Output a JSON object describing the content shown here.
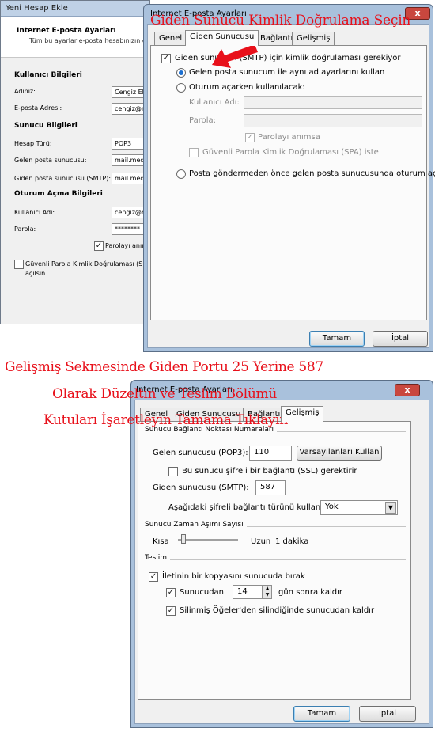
{
  "background_window": {
    "title": "Yeni Hesap Ekle",
    "header_title": "Internet E-posta Ayarları",
    "header_subtitle": "Tüm bu ayarlar e-posta hesabınızın çalışması",
    "user_info_title": "Kullanıcı Bilgileri",
    "name_label": "Adınız:",
    "name_value": "Cengiz El",
    "email_label": "E-posta Adresi:",
    "email_value": "cengiz@m",
    "server_info_title": "Sunucu Bilgileri",
    "account_type_label": "Hesap Türü:",
    "account_type_value": "POP3",
    "incoming_label": "Gelen posta sunucusu:",
    "incoming_value": "mail.med",
    "outgoing_label": "Giden posta sunucusu (SMTP):",
    "outgoing_value": "mail.med",
    "logon_info_title": "Oturum Açma Bilgileri",
    "username_label": "Kullanıcı Adı:",
    "username_value": "cengiz@m",
    "password_label": "Parola:",
    "password_value": "********",
    "remember_label": "Parolayı anım",
    "spa_label": "Güvenli Parola Kimlik Doğrulaması (SPA)",
    "spa_label_line2": "açılsın"
  },
  "dialog_top": {
    "title": "Internet E-posta Ayarları",
    "close_label": "x",
    "tabs": [
      "Genel",
      "Giden Sunucusu",
      "Bağlantı",
      "Gelişmiş"
    ],
    "smtp_auth_label": "Giden sunucum (SMTP) için kimlik doğrulaması gerekiyor",
    "same_settings_label": "Gelen posta sunucum ile aynı ad ayarlarını kullan",
    "logon_using_label": "Oturum açarken kullanılacak:",
    "username_label": "Kullanıcı Adı:",
    "password_label": "Parola:",
    "remember_label": "Parolayı anımsa",
    "spa_label": "Güvenli Parola Kimlik Doğrulaması (SPA) iste",
    "pop_before_smtp_label": "Posta göndermeden önce gelen posta sunucusunda oturum aç",
    "ok_label": "Tamam",
    "cancel_label": "İptal"
  },
  "dialog_bottom": {
    "title": "Internet E-posta Ayarları",
    "close_label": "x",
    "tabs": [
      "Genel",
      "Giden Sunucusu",
      "Bağlantı",
      "Gelişmiş"
    ],
    "port_group_title": "Sunucu Bağlantı Noktası Numaraları",
    "incoming_port_label": "Gelen sunucusu (POP3):",
    "incoming_port_value": "110",
    "defaults_button": "Varsayılanları Kullan",
    "ssl_label": "Bu sunucu şifreli bir bağlantı (SSL) gerektirir",
    "outgoing_port_label": "Giden sunucusu (SMTP):",
    "outgoing_port_value": "587",
    "encryption_label": "Aşağıdaki şifreli bağlantı türünü kullan:",
    "encryption_value": "Yok",
    "timeout_group_title": "Sunucu Zaman Aşımı Sayısı",
    "timeout_short": "Kısa",
    "timeout_long": "Uzun",
    "timeout_value": "1 dakika",
    "delivery_group_title": "Teslim",
    "leave_copy_label": "İletinin bir kopyasını sunucuda bırak",
    "remove_after_label": "Sunucudan",
    "remove_after_days": "14",
    "remove_after_suffix": "gün sonra kaldır",
    "remove_deleted_label": "Silinmiş Öğeler'den silindiğinde sunucudan kaldır",
    "ok_label": "Tamam",
    "cancel_label": "İptal"
  },
  "annotations": {
    "top": "Giden Sunucu Kimlik Doğrulama Seçin",
    "middle_line1": "Gelişmiş Sekmesinde Giden Portu 25 Yerine 587",
    "middle_line2": "Olarak Düzeltin ve Teslim  Bölümü",
    "middle_line3": "Kutuları İşaretleyin Tamama Tıklayın",
    "color": "#e8101a"
  }
}
